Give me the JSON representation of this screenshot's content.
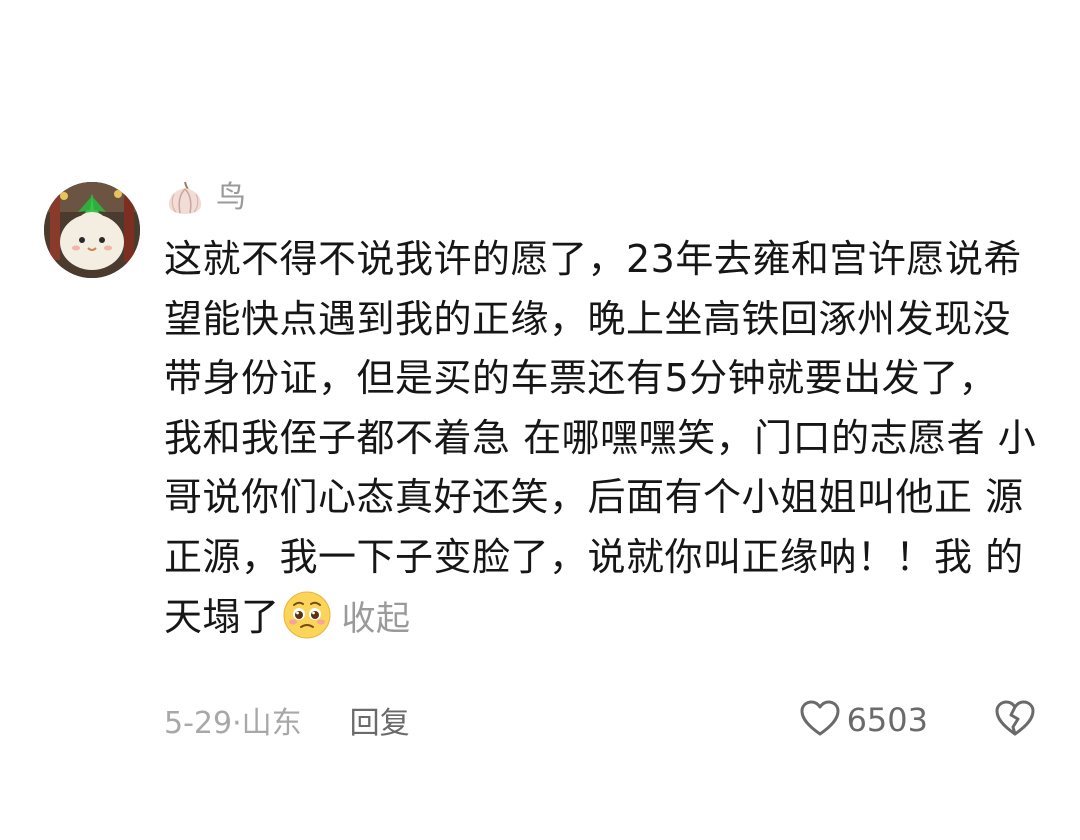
{
  "comment": {
    "username": "鸟",
    "avatar_icon": "garlic-character-avatar",
    "badge_icon": "garlic-icon",
    "content_lines": [
      "这就不得不说我许的愿了，23年去雍和宫许愿说希",
      "望能快点遇到我的正缘，晚上坐高铁回涿州发现没",
      "带身份证，但是买的车票还有5分钟就要出发了，",
      "我和我侄子都不着急 在哪嘿嘿笑，门口的志愿者",
      "小哥说你们心态真好还笑，后面有个小姐姐叫他正",
      "源正源，我一下子变脸了，说就你叫正缘呐！！我",
      "的天塌了"
    ],
    "emoji_icon": "pleading-face-emoji",
    "collapse_label": "收起",
    "date_location": "5-29·山东",
    "reply_label": "回复",
    "like_icon": "heart-outline-icon",
    "like_count": "6503",
    "dislike_icon": "broken-heart-icon"
  },
  "colors": {
    "text_primary": "#161616",
    "text_secondary": "#9a9a9a",
    "background": "#ffffff"
  }
}
